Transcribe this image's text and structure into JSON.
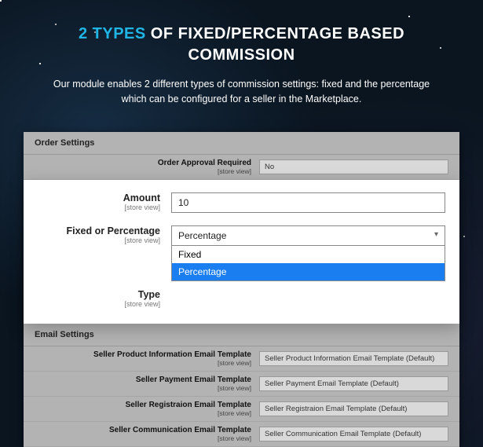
{
  "hero": {
    "title_prefix": "2 TYPES",
    "title_rest": " OF FIXED/PERCENTAGE BASED COMMISSION",
    "subtitle": "Our module enables 2 different types of commission settings: fixed and the percentage which can be configured for a seller in the Marketplace."
  },
  "scope_label": "[store view]",
  "order_settings": {
    "heading": "Order Settings",
    "approval_label": "Order Approval Required",
    "approval_value": "No"
  },
  "commission": {
    "amount_label": "Amount",
    "amount_value": "10",
    "mode_label": "Fixed or Percentage",
    "mode_selected": "Percentage",
    "mode_options": [
      "Fixed",
      "Percentage"
    ],
    "type_label": "Type"
  },
  "email_settings": {
    "heading": "Email Settings",
    "rows": [
      {
        "label": "Seller Product Information Email Template",
        "value": "Seller Product Information Email Template (Default)"
      },
      {
        "label": "Seller Payment Email Template",
        "value": "Seller Payment Email Template (Default)"
      },
      {
        "label": "Seller Registraion Email Template",
        "value": "Seller Registraion Email Template (Default)"
      },
      {
        "label": "Seller Communication Email Template",
        "value": "Seller Communication Email Template (Default)"
      }
    ]
  }
}
